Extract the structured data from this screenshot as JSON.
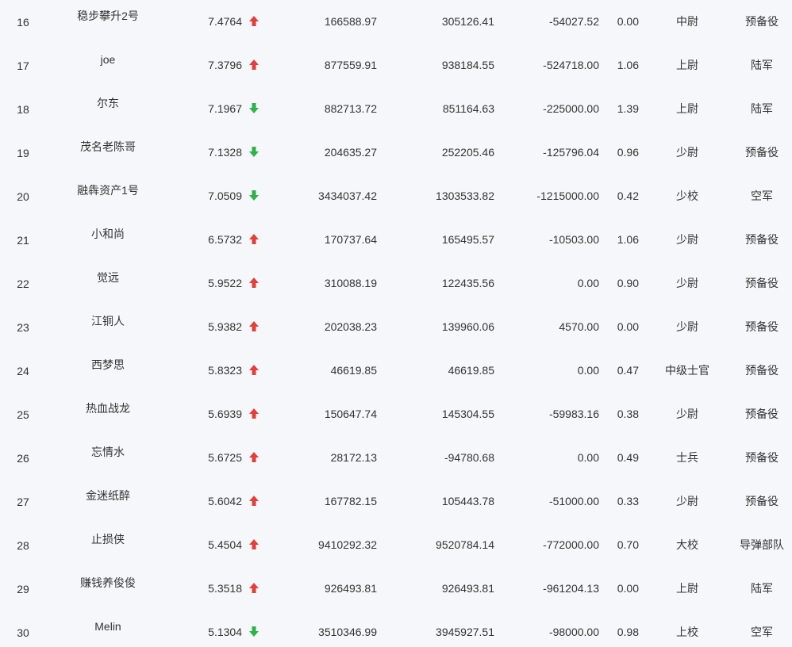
{
  "colors": {
    "up": "#e0403b",
    "down": "#2fb24a",
    "text": "#333333",
    "background": "#f6f7fa"
  },
  "rows": [
    {
      "rank": "16",
      "name": "稳步攀升2号",
      "score": "7.4764",
      "trend": "up",
      "asset": "166588.97",
      "equity": "305126.41",
      "pnl": "-54027.52",
      "ratio": "0.00",
      "military_rank": "中尉",
      "branch": "预备役"
    },
    {
      "rank": "17",
      "name": "joe",
      "score": "7.3796",
      "trend": "up",
      "asset": "877559.91",
      "equity": "938184.55",
      "pnl": "-524718.00",
      "ratio": "1.06",
      "military_rank": "上尉",
      "branch": "陆军"
    },
    {
      "rank": "18",
      "name": "尔东",
      "score": "7.1967",
      "trend": "down",
      "asset": "882713.72",
      "equity": "851164.63",
      "pnl": "-225000.00",
      "ratio": "1.39",
      "military_rank": "上尉",
      "branch": "陆军"
    },
    {
      "rank": "19",
      "name": "茂名老陈哥",
      "score": "7.1328",
      "trend": "down",
      "asset": "204635.27",
      "equity": "252205.46",
      "pnl": "-125796.04",
      "ratio": "0.96",
      "military_rank": "少尉",
      "branch": "预备役"
    },
    {
      "rank": "20",
      "name": "融犇资产1号",
      "score": "7.0509",
      "trend": "down",
      "asset": "3434037.42",
      "equity": "1303533.82",
      "pnl": "-1215000.00",
      "ratio": "0.42",
      "military_rank": "少校",
      "branch": "空军"
    },
    {
      "rank": "21",
      "name": "小和尚",
      "score": "6.5732",
      "trend": "up",
      "asset": "170737.64",
      "equity": "165495.57",
      "pnl": "-10503.00",
      "ratio": "1.06",
      "military_rank": "少尉",
      "branch": "预备役"
    },
    {
      "rank": "22",
      "name": "觉远",
      "score": "5.9522",
      "trend": "up",
      "asset": "310088.19",
      "equity": "122435.56",
      "pnl": "0.00",
      "ratio": "0.90",
      "military_rank": "少尉",
      "branch": "预备役"
    },
    {
      "rank": "23",
      "name": "江铜人",
      "score": "5.9382",
      "trend": "up",
      "asset": "202038.23",
      "equity": "139960.06",
      "pnl": "4570.00",
      "ratio": "0.00",
      "military_rank": "少尉",
      "branch": "预备役"
    },
    {
      "rank": "24",
      "name": "西梦思",
      "score": "5.8323",
      "trend": "up",
      "asset": "46619.85",
      "equity": "46619.85",
      "pnl": "0.00",
      "ratio": "0.47",
      "military_rank": "中级士官",
      "branch": "预备役"
    },
    {
      "rank": "25",
      "name": "热血战龙",
      "score": "5.6939",
      "trend": "up",
      "asset": "150647.74",
      "equity": "145304.55",
      "pnl": "-59983.16",
      "ratio": "0.38",
      "military_rank": "少尉",
      "branch": "预备役"
    },
    {
      "rank": "26",
      "name": "忘情水",
      "score": "5.6725",
      "trend": "up",
      "asset": "28172.13",
      "equity": "-94780.68",
      "pnl": "0.00",
      "ratio": "0.49",
      "military_rank": "士兵",
      "branch": "预备役"
    },
    {
      "rank": "27",
      "name": "金迷纸醉",
      "score": "5.6042",
      "trend": "up",
      "asset": "167782.15",
      "equity": "105443.78",
      "pnl": "-51000.00",
      "ratio": "0.33",
      "military_rank": "少尉",
      "branch": "预备役"
    },
    {
      "rank": "28",
      "name": "止损侠",
      "score": "5.4504",
      "trend": "up",
      "asset": "9410292.32",
      "equity": "9520784.14",
      "pnl": "-772000.00",
      "ratio": "0.70",
      "military_rank": "大校",
      "branch": "导弹部队"
    },
    {
      "rank": "29",
      "name": "赚钱养俊俊",
      "score": "5.3518",
      "trend": "up",
      "asset": "926493.81",
      "equity": "926493.81",
      "pnl": "-961204.13",
      "ratio": "0.00",
      "military_rank": "上尉",
      "branch": "陆军"
    },
    {
      "rank": "30",
      "name": "Melin",
      "score": "5.1304",
      "trend": "down",
      "asset": "3510346.99",
      "equity": "3945927.51",
      "pnl": "-98000.00",
      "ratio": "0.98",
      "military_rank": "上校",
      "branch": "空军"
    }
  ]
}
